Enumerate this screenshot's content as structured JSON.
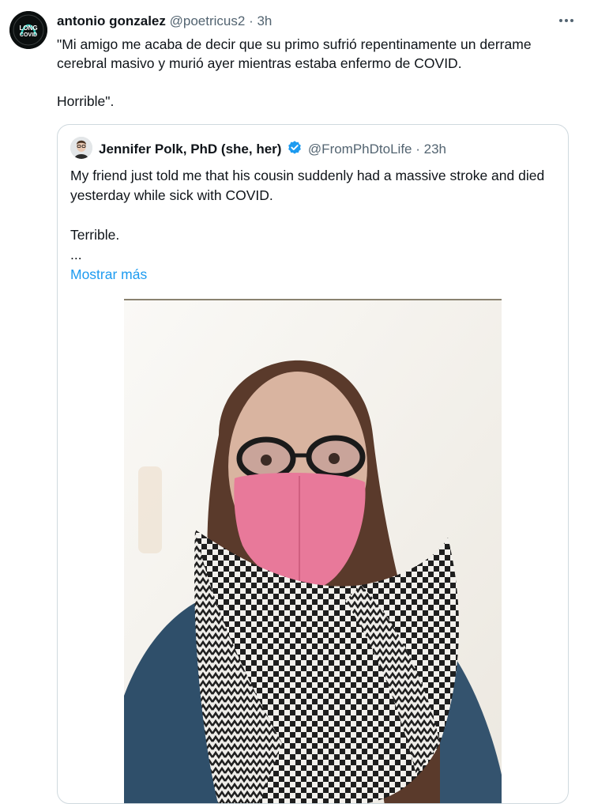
{
  "tweet": {
    "display_name": "antonio gonzalez",
    "handle": "@poetricus2",
    "separator": "·",
    "time": "3h",
    "avatar_text_top": "LONG",
    "avatar_text_bottom": "COVID",
    "more_icon": "ellipsis-icon",
    "text_line1": "\"Mi amigo me acaba de decir que su primo sufrió repentinamente un derrame cerebral masivo y murió ayer mientras estaba enfermo de COVID.",
    "text_line2": " Horrible\"."
  },
  "quote": {
    "display_name": "Jennifer Polk, PhD (she, her)",
    "handle": "@FromPhDtoLife",
    "separator": "·",
    "time": "23h",
    "verified_icon": "verified-badge-icon",
    "text_line1": "My friend just told me that his cousin suddenly had a massive stroke and died yesterday while sick with COVID.",
    "text_line2": "Terrible.",
    "ellipsis": "...",
    "show_more": "Mostrar más"
  },
  "colors": {
    "text_primary": "#0f1419",
    "text_secondary": "#536471",
    "link": "#1d9bf0",
    "border": "#cfd9de",
    "mask_pink": "#e8799a"
  }
}
